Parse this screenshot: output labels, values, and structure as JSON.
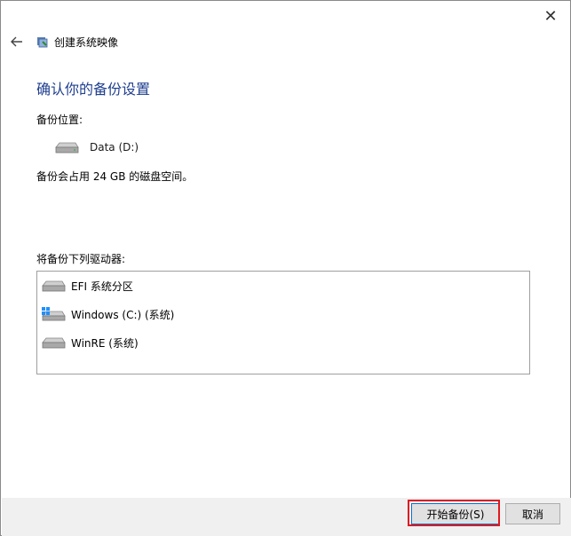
{
  "window": {
    "title": "创建系统映像",
    "close_glyph": "✕"
  },
  "main": {
    "heading": "确认你的备份设置",
    "backup_location_label": "备份位置:",
    "backup_location_drive": "Data (D:)",
    "space_note": "备份会占用 24 GB 的磁盘空间。",
    "drives_label": "将备份下列驱动器:",
    "drives": [
      {
        "label": "EFI 系统分区",
        "icon": "drive-icon"
      },
      {
        "label": "Windows (C:) (系统)",
        "icon": "windows-drive-icon"
      },
      {
        "label": "WinRE (系统)",
        "icon": "drive-icon"
      }
    ]
  },
  "buttons": {
    "start_backup": "开始备份(S)",
    "cancel": "取消"
  },
  "colors": {
    "heading": "#1f3f8f",
    "highlight_border": "#e0191f",
    "footer_bg": "#f0f0f0"
  }
}
